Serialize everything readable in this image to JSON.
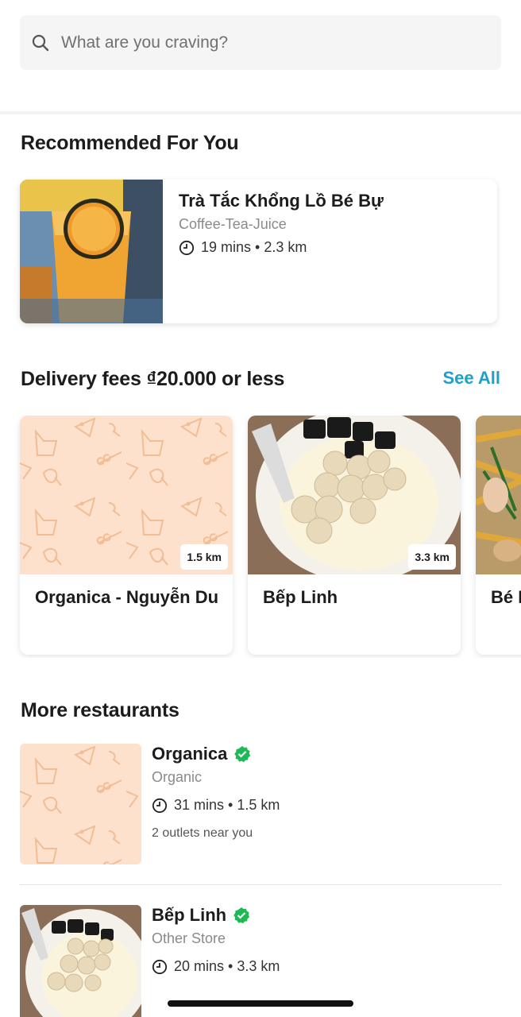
{
  "search": {
    "placeholder": "What are you craving?"
  },
  "recommended": {
    "title": "Recommended For You",
    "items": [
      {
        "name": "Trà Tắc Khổng Lồ Bé Bự",
        "category": "Coffee-Tea-Juice",
        "time": "19 mins",
        "distance": "2.3 km"
      }
    ]
  },
  "delivery": {
    "title": "Delivery fees ₫20.000 or less",
    "see_all": "See All",
    "items": [
      {
        "name": "Organica - Nguyễn Du",
        "distance": "1.5 km"
      },
      {
        "name": "Bếp Linh",
        "distance": "3.3 km"
      },
      {
        "name": "Bé N"
      }
    ]
  },
  "more": {
    "title": "More restaurants",
    "items": [
      {
        "name": "Organica",
        "category": "Organic",
        "time": "31 mins",
        "distance": "1.5 km",
        "outlets": "2 outlets near you"
      },
      {
        "name": "Bếp Linh",
        "category": "Other Store",
        "time": "20 mins",
        "distance": "3.3 km"
      }
    ]
  },
  "colors": {
    "accent": "#1ea0c8",
    "verified": "#1db954",
    "placeholder_bg": "#fde1cc",
    "placeholder_icon": "#f2bd94"
  }
}
